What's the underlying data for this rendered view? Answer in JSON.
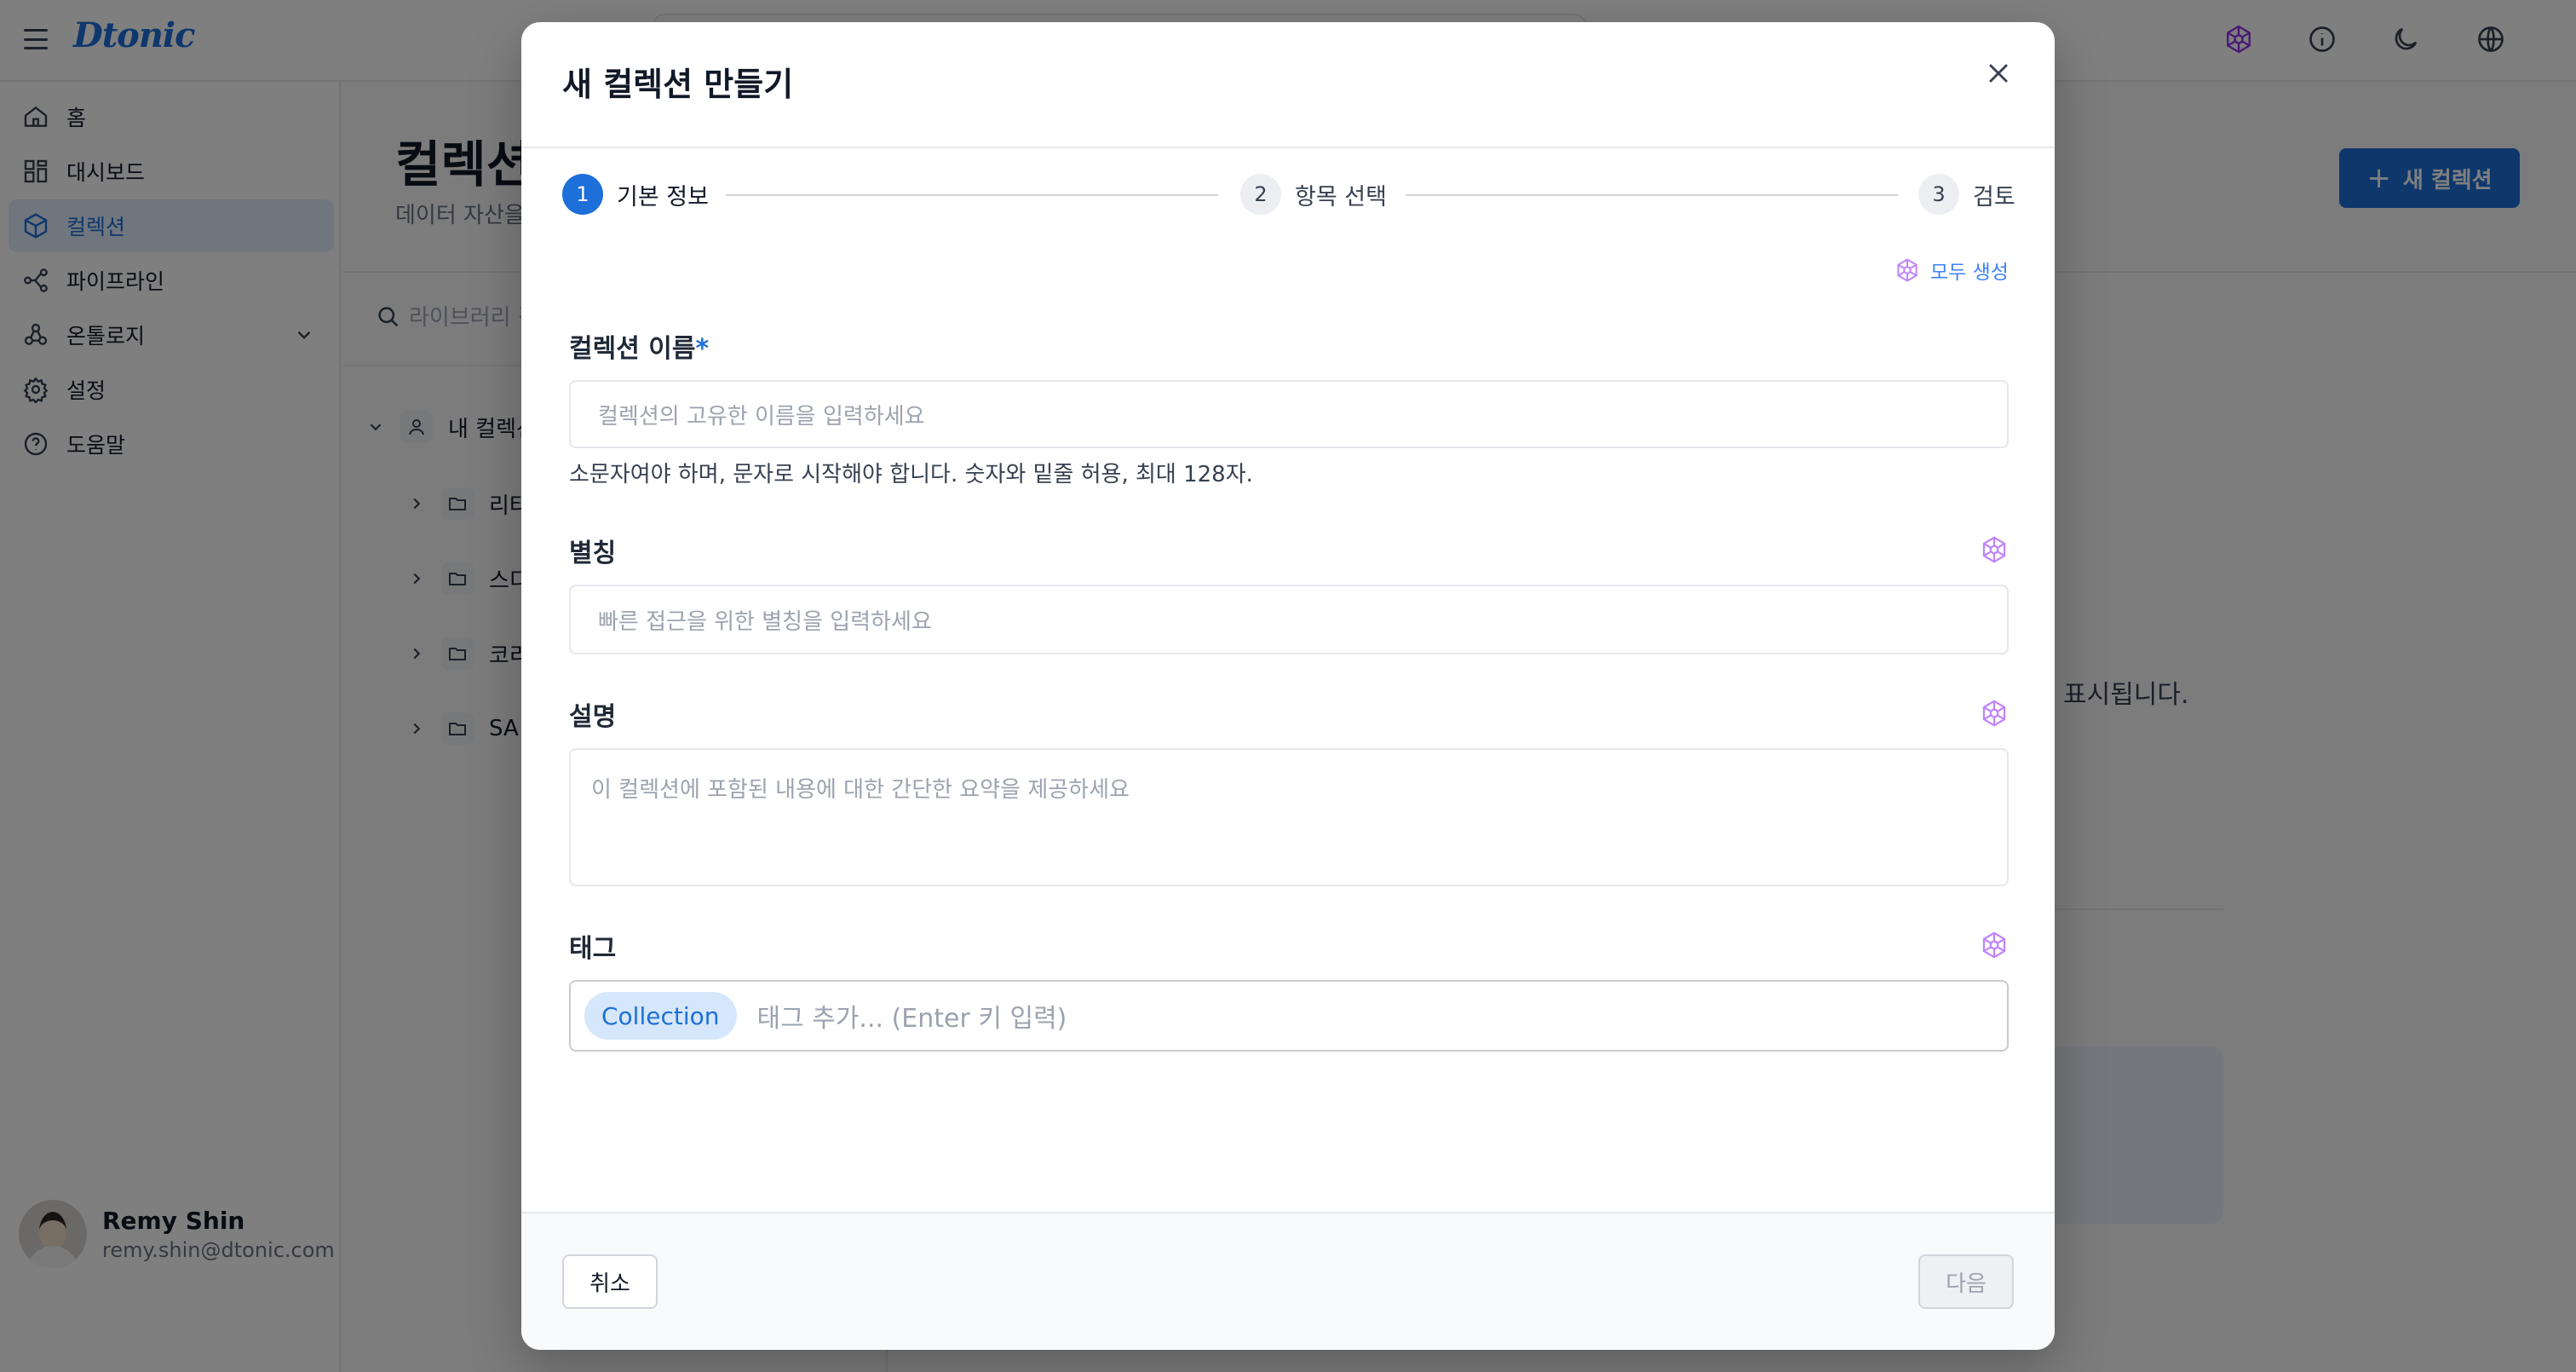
{
  "app": {
    "logo": "Dtonic",
    "sidebar": {
      "items": [
        {
          "label": "홈"
        },
        {
          "label": "대시보드"
        },
        {
          "label": "컬렉션"
        },
        {
          "label": "파이프라인"
        },
        {
          "label": "온톨로지"
        },
        {
          "label": "설정"
        },
        {
          "label": "도움말"
        }
      ],
      "active": "컬렉션"
    },
    "user": {
      "name": "Remy Shin",
      "email": "remy.shin@dtonic.com"
    },
    "main": {
      "title": "컬렉션",
      "subtitle": "데이터 자산을",
      "new_button": "새 컬렉션",
      "library_search_placeholder": "라이브러리 검색",
      "tree": {
        "root": "내 컬렉션",
        "children": [
          "리터",
          "스디",
          "코리",
          "SA"
        ]
      },
      "empty_text": "표시됩니다."
    }
  },
  "modal": {
    "title": "새 컬렉션 만들기",
    "steps": [
      {
        "num": "1",
        "label": "기본 정보"
      },
      {
        "num": "2",
        "label": "항목 선택"
      },
      {
        "num": "3",
        "label": "검토"
      }
    ],
    "generate_all": "모두 생성",
    "name": {
      "label": "컬렉션 이름",
      "required_mark": "*",
      "placeholder": "컬렉션의 고유한 이름을 입력하세요",
      "helper": "소문자여야 하며, 문자로 시작해야 합니다. 숫자와 밑줄 허용, 최대 128자."
    },
    "alias": {
      "label": "별칭",
      "placeholder": "빠른 접근을 위한 별칭을 입력하세요"
    },
    "description": {
      "label": "설명",
      "placeholder": "이 컬렉션에 포함된 내용에 대한 간단한 요약을 제공하세요"
    },
    "tags": {
      "label": "태그",
      "chips": [
        "Collection"
      ],
      "placeholder": "태그 추가... (Enter 키 입력)"
    },
    "footer": {
      "cancel": "취소",
      "next": "다음"
    }
  },
  "colors": {
    "accent": "#1d6fd9",
    "ai_icon": "#c084fc"
  }
}
